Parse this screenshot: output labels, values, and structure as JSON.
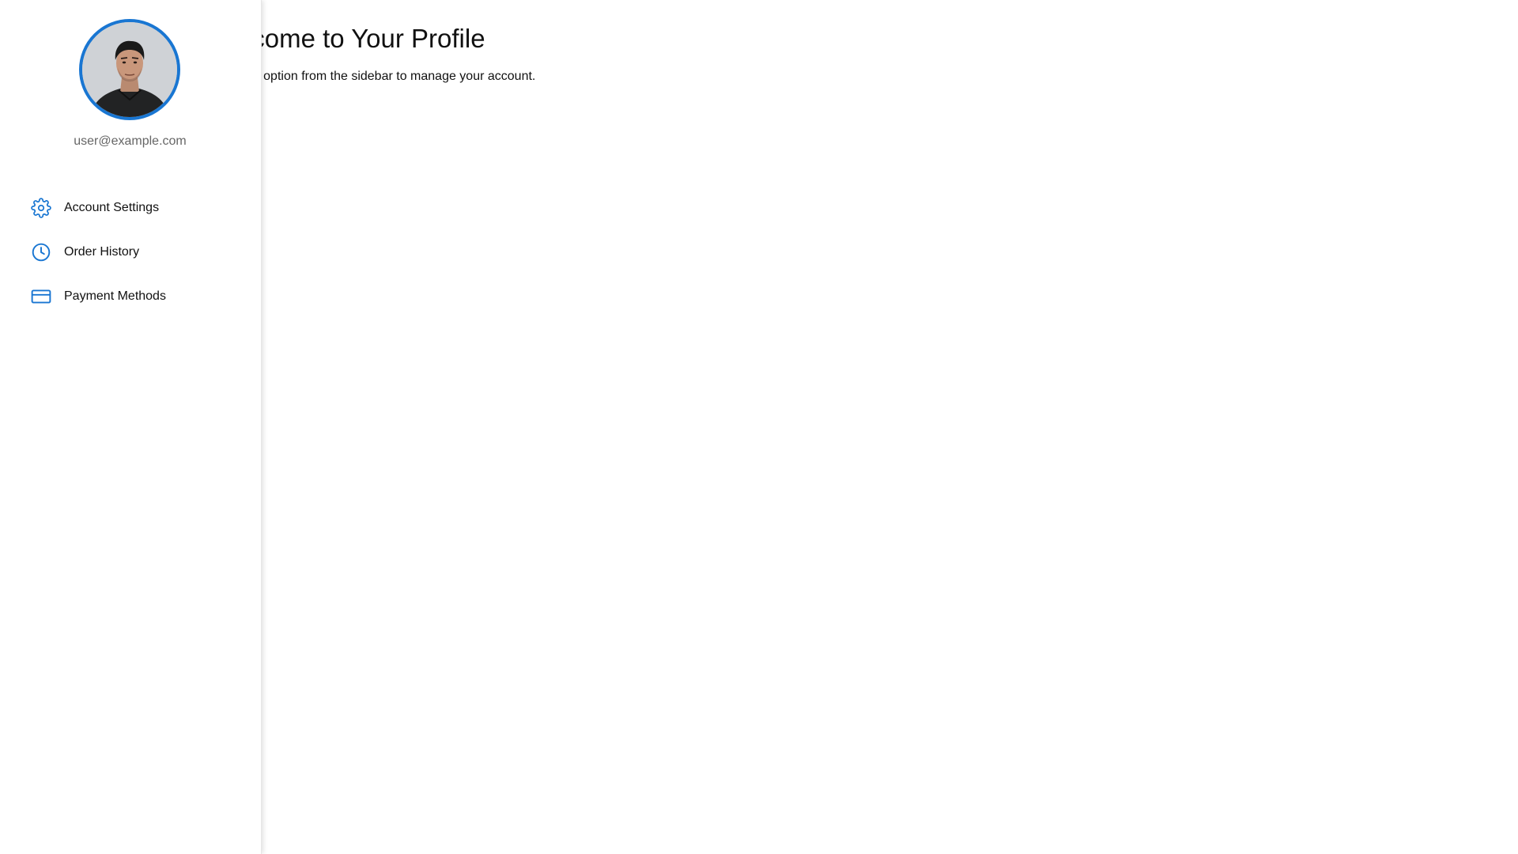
{
  "main": {
    "title": "Welcome to Your Profile",
    "description": "Select an option from the sidebar to manage your account."
  },
  "sidebar": {
    "email": "user@example.com",
    "accent_color": "#1976d2",
    "items": [
      {
        "label": "Account Settings",
        "icon": "gear-icon"
      },
      {
        "label": "Order History",
        "icon": "clock-icon"
      },
      {
        "label": "Payment Methods",
        "icon": "credit-card-icon"
      }
    ]
  }
}
